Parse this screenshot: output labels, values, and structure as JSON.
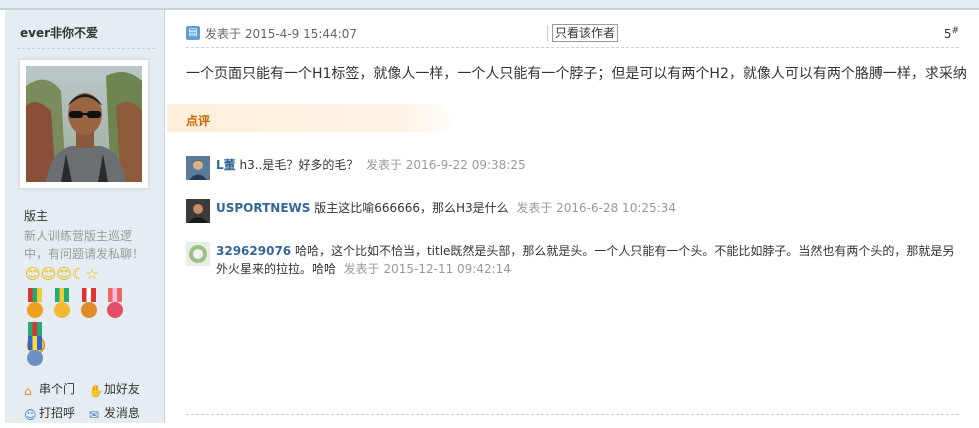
{
  "author": {
    "name": "ever非你不爱",
    "group_title": "版主",
    "group_desc": "新人训练营版主巡逻中，有问题请发私聊！",
    "smileys": "😊😊😊☾☆",
    "links": [
      {
        "label": "串个门",
        "icon": "home-icon"
      },
      {
        "label": "加好友",
        "icon": "handshake-icon"
      },
      {
        "label": "打招呼",
        "icon": "user-wave-icon"
      },
      {
        "label": "发消息",
        "icon": "mail-icon"
      }
    ]
  },
  "post": {
    "time": "发表于 2015-4-9 15:44:07",
    "only_author": "只看该作者",
    "floor": "5",
    "floor_mark": "#",
    "body": "一个页面只能有一个H1标签，就像人一样，一个人只能有一个脖子；但是可以有两个H2，就像人可以有两个胳膊一样，求采纳"
  },
  "rate": {
    "label": "点评"
  },
  "comments": [
    {
      "name": "L董",
      "msg": " h3..是毛？好多的毛？",
      "time": "发表于 2016-9-22 09:38:25"
    },
    {
      "name": "USPORTNEWS",
      "msg": " 版主这比喻666666，那么H3是什么",
      "time": "发表于 2016-6-28 10:25:34"
    },
    {
      "name": "329629076",
      "msg": " 哈哈，这个比如不恰当，title既然是头部，那么就是头。一个人只能有一个头。不能比如脖子。当然也有两个头的，那就是另外火星来的拉拉。哈哈",
      "time": "发表于 2015-12-11 09:42:14"
    }
  ],
  "colors": {
    "link": "#336699",
    "rate_label": "#cc6600",
    "sidebar_bg": "#e5edf2"
  }
}
